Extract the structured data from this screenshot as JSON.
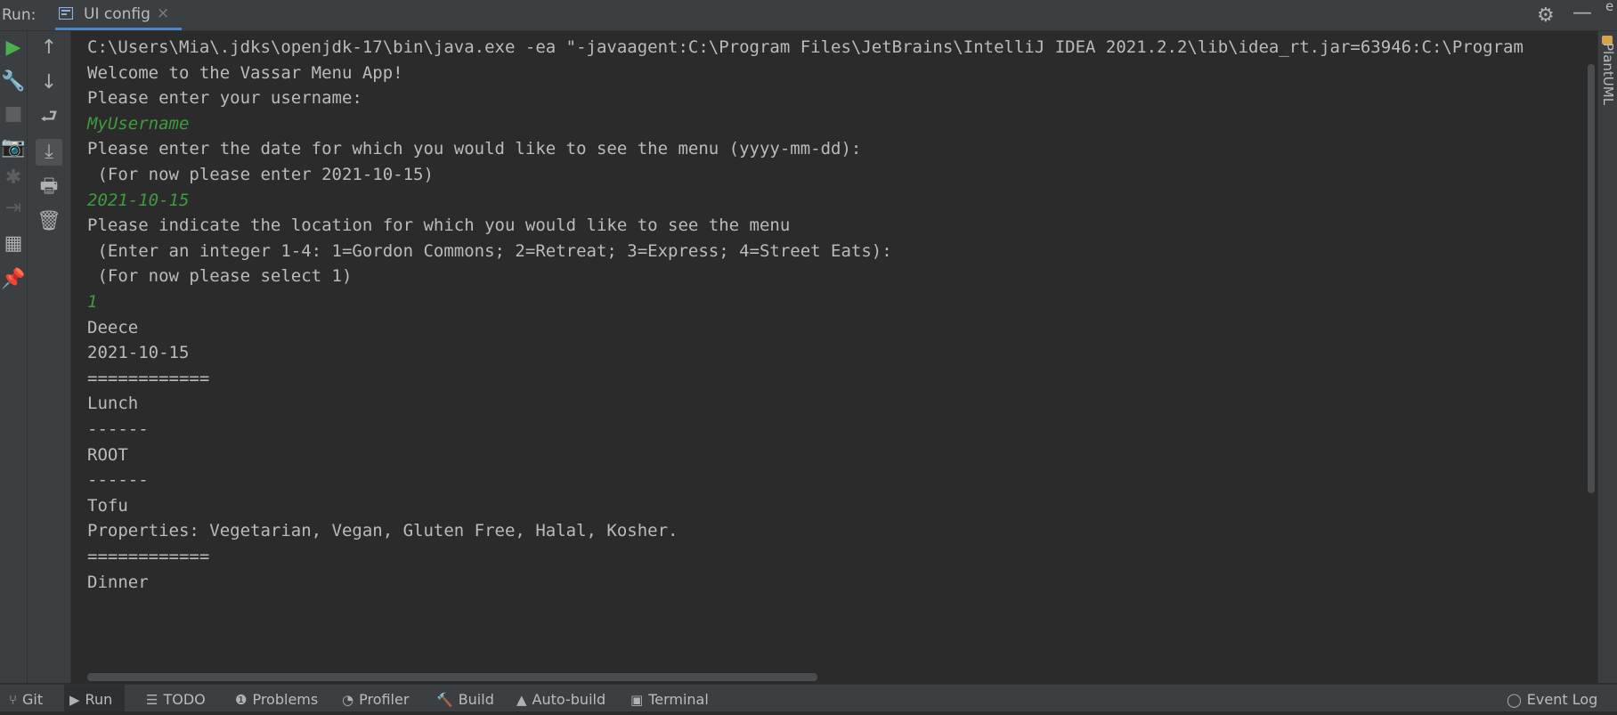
{
  "header": {
    "run_label": "Run:",
    "tab_title": "UI config",
    "tab_close": "×",
    "settings_glyph": "⚙",
    "minimize_glyph": "—"
  },
  "console_lines": [
    {
      "text": "C:\\Users\\Mia\\.jdks\\openjdk-17\\bin\\java.exe -ea \"-javaagent:C:\\Program Files\\JetBrains\\IntelliJ IDEA 2021.2.2\\lib\\idea_rt.jar=63946:C:\\Program",
      "type": "output"
    },
    {
      "text": "Welcome to the Vassar Menu App!",
      "type": "output"
    },
    {
      "text": "Please enter your username:",
      "type": "output"
    },
    {
      "text": "MyUsername",
      "type": "input"
    },
    {
      "text": "Please enter the date for which you would like to see the menu (yyyy-mm-dd):",
      "type": "output"
    },
    {
      "text": " (For now please enter 2021-10-15)",
      "type": "output"
    },
    {
      "text": "2021-10-15",
      "type": "input"
    },
    {
      "text": "Please indicate the location for which you would like to see the menu",
      "type": "output"
    },
    {
      "text": " (Enter an integer 1-4: 1=Gordon Commons; 2=Retreat; 3=Express; 4=Street Eats):",
      "type": "output"
    },
    {
      "text": " (For now please select 1)",
      "type": "output"
    },
    {
      "text": "1",
      "type": "input"
    },
    {
      "text": "Deece",
      "type": "output"
    },
    {
      "text": "2021-10-15",
      "type": "output"
    },
    {
      "text": "============",
      "type": "output"
    },
    {
      "text": "Lunch",
      "type": "output"
    },
    {
      "text": "------",
      "type": "output"
    },
    {
      "text": "ROOT",
      "type": "output"
    },
    {
      "text": "------",
      "type": "output"
    },
    {
      "text": "Tofu",
      "type": "output"
    },
    {
      "text": "Properties: Vegetarian, Vegan, Gluten Free, Halal, Kosher.",
      "type": "output"
    },
    {
      "text": "============",
      "type": "output"
    },
    {
      "text": "Dinner",
      "type": "output"
    }
  ],
  "left_toolbar": [
    {
      "name": "run-icon",
      "glyph": "▶",
      "color": "#4caf50",
      "interactable": true,
      "dim": false
    },
    {
      "name": "wrench-icon",
      "glyph": "🔧",
      "color": "#afb1b3",
      "interactable": true,
      "dim": false
    },
    {
      "name": "stop-icon",
      "glyph": "■",
      "color": "#5c5f61",
      "interactable": true,
      "dim": true
    },
    {
      "name": "camera-icon",
      "glyph": "📷",
      "color": "#5c5f61",
      "interactable": true,
      "dim": true
    },
    {
      "name": "debug-icon",
      "glyph": "✱",
      "color": "#5c5f61",
      "interactable": true,
      "dim": true
    },
    {
      "name": "exit-icon",
      "glyph": "⇥",
      "color": "#5c5f61",
      "interactable": true,
      "dim": true
    },
    {
      "name": "layout-icon",
      "glyph": "▦",
      "color": "#afb1b3",
      "interactable": true,
      "dim": false
    },
    {
      "name": "pin-icon",
      "glyph": "📌",
      "color": "#afb1b3",
      "interactable": true,
      "dim": false
    }
  ],
  "console_toolbar": [
    {
      "name": "up-arrow-icon",
      "glyph": "↑",
      "active": false
    },
    {
      "name": "down-arrow-icon",
      "glyph": "↓",
      "active": false
    },
    {
      "name": "soft-wrap-icon",
      "glyph": "⮐",
      "active": false
    },
    {
      "name": "scroll-to-end-icon",
      "glyph": "⤓",
      "active": true
    },
    {
      "name": "print-icon",
      "glyph": "🖶",
      "active": false
    },
    {
      "name": "trash-icon",
      "glyph": "🗑",
      "active": false
    }
  ],
  "right_panel": {
    "label": "PlantUML",
    "top_char": "e"
  },
  "bottom_tabs": [
    {
      "name": "git",
      "label": "Git",
      "icon": "⑂",
      "active": false
    },
    {
      "name": "run",
      "label": "Run",
      "icon": "▶",
      "active": true
    },
    {
      "name": "todo",
      "label": "TODO",
      "icon": "☰",
      "active": false
    },
    {
      "name": "problems",
      "label": "Problems",
      "icon": "❶",
      "active": false
    },
    {
      "name": "profiler",
      "label": "Profiler",
      "icon": "◔",
      "active": false
    },
    {
      "name": "build",
      "label": "Build",
      "icon": "🔨",
      "active": false
    },
    {
      "name": "auto-build",
      "label": "Auto-build",
      "icon": "▲",
      "active": false
    },
    {
      "name": "terminal",
      "label": "Terminal",
      "icon": "▣",
      "active": false
    },
    {
      "name": "event-log",
      "label": "Event Log",
      "icon": "◯",
      "active": false
    }
  ],
  "colors": {
    "input_text": "#3f9b3f",
    "output_text": "#bbbbbb",
    "tab_underline": "#4a88c7",
    "background": "#2b2b2b",
    "panel": "#3c3f41"
  }
}
